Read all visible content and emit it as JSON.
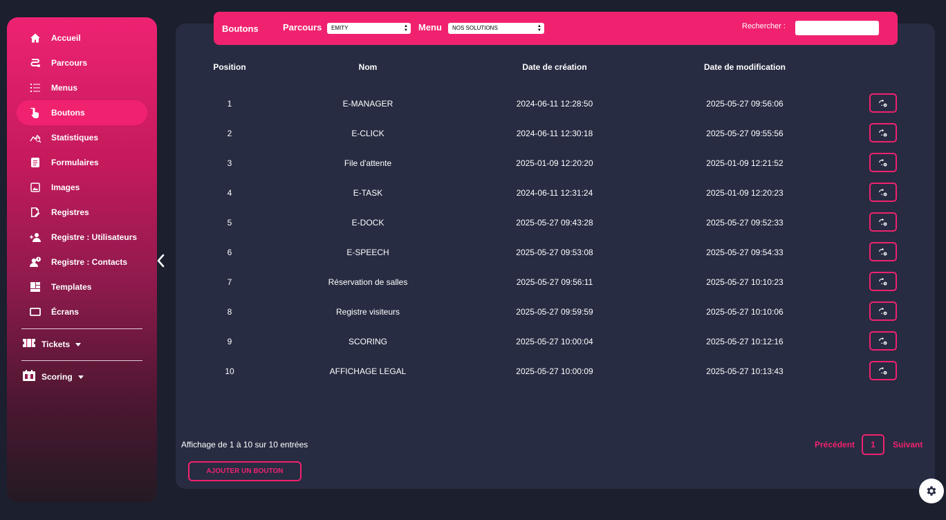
{
  "sidebar": {
    "items": [
      {
        "label": "Accueil",
        "icon": "home-icon"
      },
      {
        "label": "Parcours",
        "icon": "route-icon"
      },
      {
        "label": "Menus",
        "icon": "list-icon"
      },
      {
        "label": "Boutons",
        "icon": "pointer-hand-icon",
        "active": true
      },
      {
        "label": "Statistiques",
        "icon": "chart-line-icon"
      },
      {
        "label": "Formulaires",
        "icon": "form-icon"
      },
      {
        "label": "Images",
        "icon": "image-icon"
      },
      {
        "label": "Registres",
        "icon": "edit-document-icon"
      },
      {
        "label": "Registre : Utilisateurs",
        "icon": "user-plus-icon"
      },
      {
        "label": "Registre : Contacts",
        "icon": "user-info-icon"
      },
      {
        "label": "Templates",
        "icon": "templates-icon"
      },
      {
        "label": "Écrans",
        "icon": "screen-icon"
      }
    ],
    "groups": [
      {
        "label": "Tickets",
        "icon": "ticket-icon"
      },
      {
        "label": "Scoring",
        "icon": "scoreboard-icon"
      }
    ]
  },
  "toolbar": {
    "title": "Boutons",
    "parcours_label": "Parcours",
    "parcours_value": "EMITY",
    "menu_label": "Menu",
    "menu_value": "NOS SOLUTIONS",
    "search_label": "Rechercher :",
    "search_value": ""
  },
  "table": {
    "headers": {
      "position": "Position",
      "nom": "Nom",
      "created": "Date de création",
      "modified": "Date de modification"
    },
    "rows": [
      {
        "position": "1",
        "nom": "E-MANAGER",
        "created": "2024-06-11 12:28:50",
        "modified": "2025-05-27 09:56:06"
      },
      {
        "position": "2",
        "nom": "E-CLICK",
        "created": "2024-06-11 12:30:18",
        "modified": "2025-05-27 09:55:56"
      },
      {
        "position": "3",
        "nom": "File d'attente",
        "created": "2025-01-09 12:20:20",
        "modified": "2025-01-09 12:21:52"
      },
      {
        "position": "4",
        "nom": "E-TASK",
        "created": "2024-06-11 12:31:24",
        "modified": "2025-01-09 12:20:23"
      },
      {
        "position": "5",
        "nom": "E-DOCK",
        "created": "2025-05-27 09:43:28",
        "modified": "2025-05-27 09:52:33"
      },
      {
        "position": "6",
        "nom": "E-SPEECH",
        "created": "2025-05-27 09:53:08",
        "modified": "2025-05-27 09:54:33"
      },
      {
        "position": "7",
        "nom": "Réservation de salles",
        "created": "2025-05-27 09:56:11",
        "modified": "2025-05-27 10:10:23"
      },
      {
        "position": "8",
        "nom": "Registre visiteurs",
        "created": "2025-05-27 09:59:59",
        "modified": "2025-05-27 10:10:06"
      },
      {
        "position": "9",
        "nom": "SCORING",
        "created": "2025-05-27 10:00:04",
        "modified": "2025-05-27 10:12:16"
      },
      {
        "position": "10",
        "nom": "AFFICHAGE LEGAL",
        "created": "2025-05-27 10:00:09",
        "modified": "2025-05-27 10:13:43"
      }
    ],
    "row_action_icon": "edit-settings-icon"
  },
  "footer": {
    "info": "Affichage de 1 à 10 sur 10 entrées",
    "prev": "Précédent",
    "page": "1",
    "next": "Suivant",
    "add_button": "AJOUTER UN BOUTON"
  },
  "colors": {
    "accent": "#f0226f",
    "panel": "#272c42",
    "background": "#1b1f2e"
  }
}
